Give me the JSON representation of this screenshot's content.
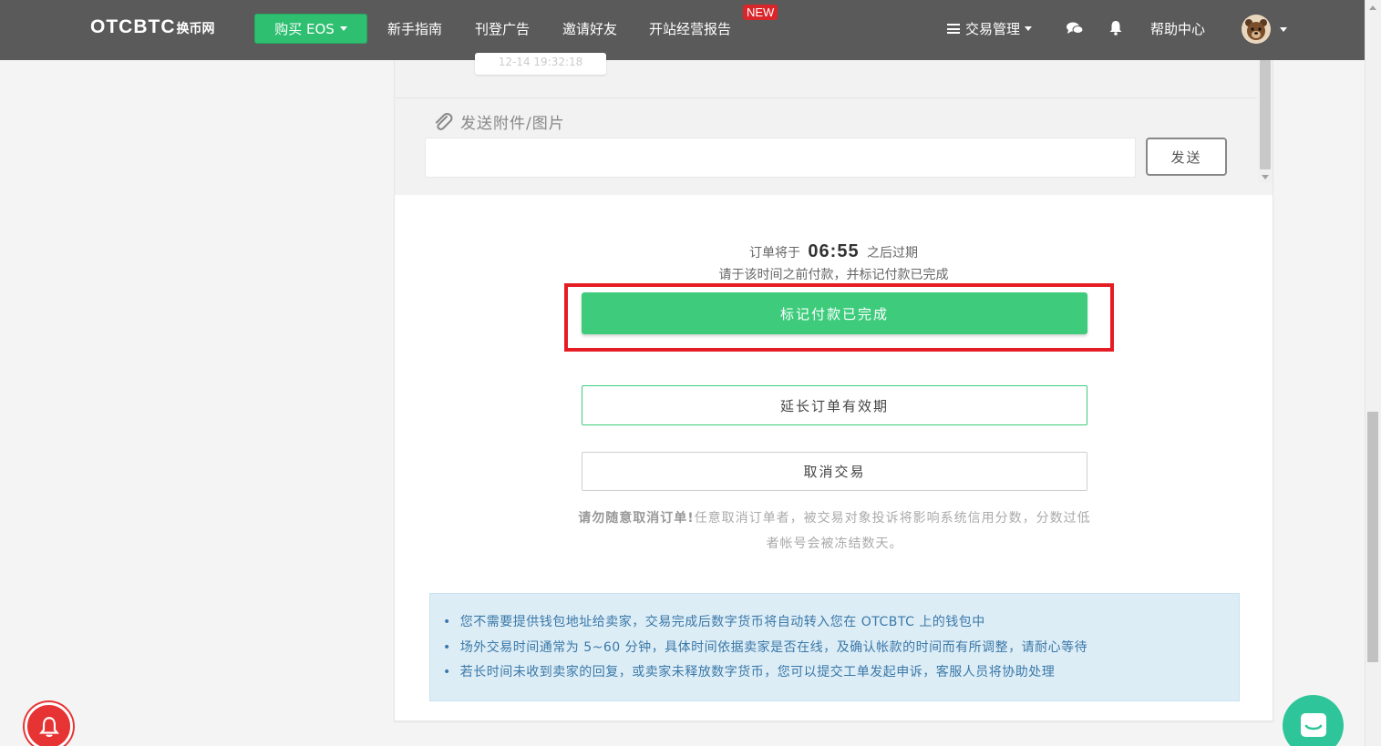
{
  "navbar": {
    "brand_main": "OTCBTC",
    "brand_sub": "换币网",
    "buy_label": "购买 EOS",
    "links": [
      "新手指南",
      "刊登广告",
      "邀请好友",
      "开站经营报告"
    ],
    "new_badge": "NEW",
    "trade_management": "交易管理",
    "help_center": "帮助中心",
    "icons": [
      "list-icon",
      "chat-icon",
      "bell-icon",
      "avatar"
    ]
  },
  "chat": {
    "last_message_time": "12-14 19:32:18",
    "attach_label": "发送附件/图片",
    "input_value": "",
    "input_placeholder": "",
    "send_label": "发送"
  },
  "order": {
    "expire_prefix": "订单将于",
    "countdown": "06:55",
    "expire_suffix": "之后过期",
    "hint": "请于该时间之前付款，并标记付款已完成",
    "mark_paid_label": "标记付款已完成",
    "extend_label": "延长订单有效期",
    "cancel_label": "取消交易",
    "warning_bold": "请勿随意取消订单!",
    "warning_text": "任意取消订单者，被交易对象投诉将影响系统信用分数，分数过低者帐号会被冻结数天。"
  },
  "info": {
    "items": [
      "您不需要提供钱包地址给卖家，交易完成后数字货币将自动转入您在 OTCBTC 上的钱包中",
      "场外交易时间通常为 5~60 分钟，具体时间依据卖家是否在线，及确认帐款的时间而有所调整，请耐心等待",
      "若长时间未收到卖家的回复，或卖家未释放数字货币，您可以提交工单发起申诉，客服人员将协助处理"
    ]
  },
  "colors": {
    "navbar": "#5a5a5a",
    "primary_green": "#3ecc7c",
    "highlight_red": "#e51c23",
    "info_bg": "#dcedf6",
    "info_text": "#3b78a8"
  }
}
